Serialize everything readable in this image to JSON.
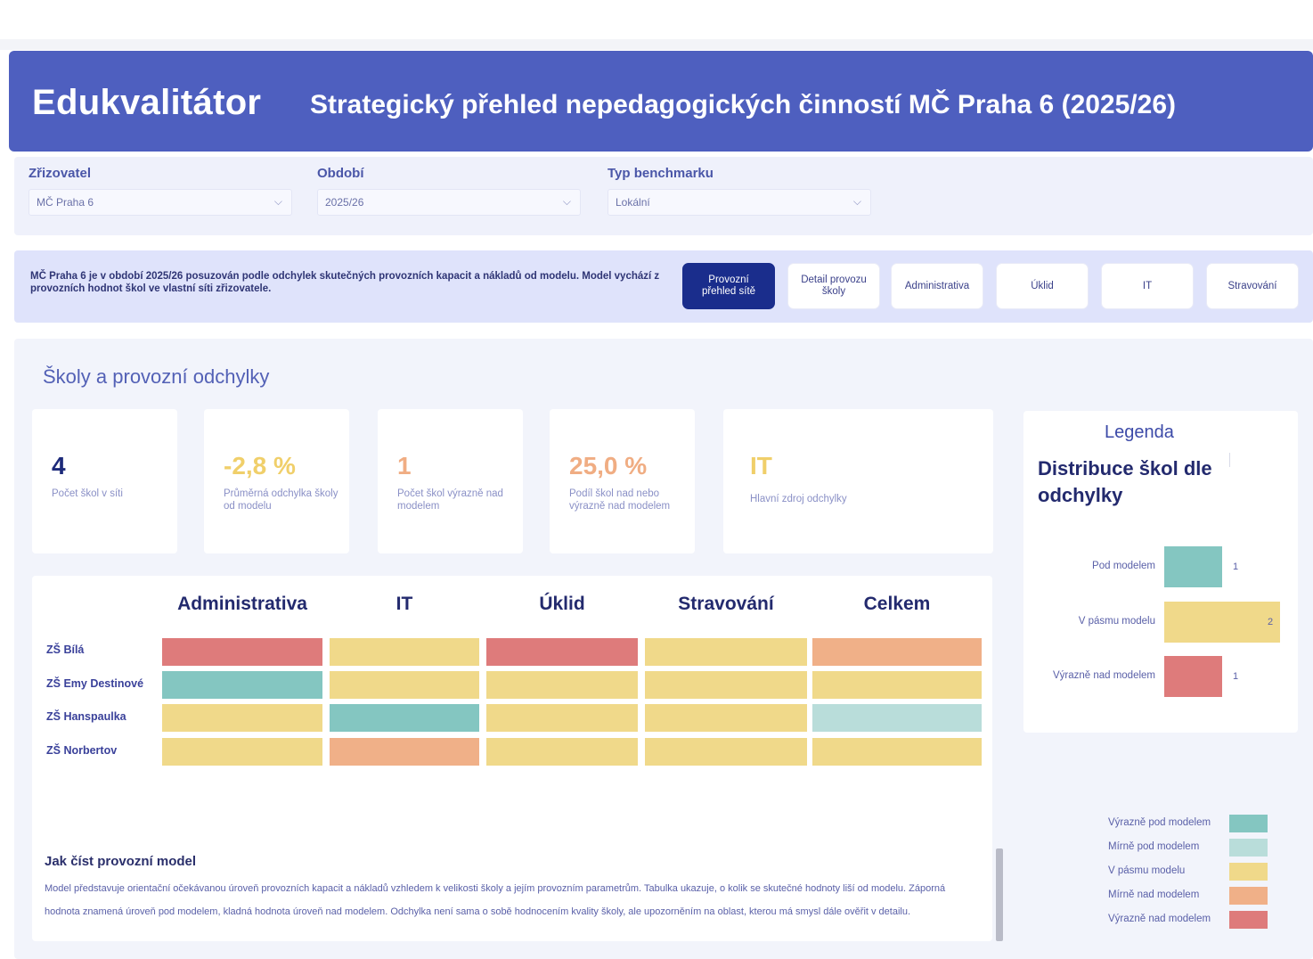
{
  "app": {
    "brand": "Edukvalitátor",
    "title": "Strategický přehled nepedagogických činností MČ Praha 6 (2025/26)"
  },
  "filters": [
    {
      "label": "Zřizovatel",
      "value": "MČ Praha 6"
    },
    {
      "label": "Období",
      "value": "2025/26"
    },
    {
      "label": "Typ benchmarku",
      "value": "Lokální"
    }
  ],
  "info": {
    "text": "MČ Praha 6 je v období 2025/26 posuzován podle odchylek skutečných provozních kapacit a nákladů od modelu. Model vychází z provozních hodnot škol ve vlastní síti zřizovatele."
  },
  "nav": [
    {
      "label": "Provozní přehled sítě",
      "active": true
    },
    {
      "label": "Detail provozu školy",
      "active": false
    },
    {
      "label": "Administrativa",
      "active": false
    },
    {
      "label": "Úklid",
      "active": false
    },
    {
      "label": "IT",
      "active": false
    },
    {
      "label": "Stravování",
      "active": false
    }
  ],
  "section": {
    "title": "Školy a provozní odchylky"
  },
  "kpis": [
    {
      "value": "4",
      "label": "Počet škol v síti",
      "color": "#1d2a7a"
    },
    {
      "value": "-2,8 %",
      "label": "Průměrná odchylka školy od modelu",
      "color": "#f0cf6a"
    },
    {
      "value": "1",
      "label": "Počet škol výrazně nad modelem",
      "color": "#f0ad83"
    },
    {
      "value": "25,0 %",
      "label": "Podíl škol nad nebo výrazně nad modelem",
      "color": "#f0ad83"
    },
    {
      "value": "IT",
      "label": "Hlavní zdroj odchylky",
      "color": "#f0cf6a"
    }
  ],
  "heatmap": {
    "columns": [
      "Administrativa",
      "IT",
      "Úklid",
      "Stravování",
      "Celkem"
    ],
    "rows": [
      {
        "name": "ZŠ Bílá",
        "cells": [
          "vyrazne_nad",
          "v_pasmu",
          "vyrazne_nad",
          "v_pasmu",
          "mirne_nad"
        ]
      },
      {
        "name": "ZŠ Emy Destinové",
        "cells": [
          "vyrazne_pod",
          "v_pasmu",
          "v_pasmu",
          "v_pasmu",
          "v_pasmu"
        ]
      },
      {
        "name": "ZŠ Hanspaulka",
        "cells": [
          "v_pasmu",
          "vyrazne_pod",
          "v_pasmu",
          "v_pasmu",
          "mirne_pod"
        ]
      },
      {
        "name": "ZŠ Norbertov",
        "cells": [
          "v_pasmu",
          "mirne_nad",
          "v_pasmu",
          "v_pasmu",
          "v_pasmu"
        ]
      }
    ]
  },
  "howto": {
    "title": "Jak číst provozní model",
    "text": "Model představuje orientační očekávanou úroveň provozních kapacit a nákladů vzhledem k velikosti školy a jejím provozním parametrům. Tabulka ukazuje, o kolik se skutečné hodnoty liší od modelu. Záporná hodnota znamená úroveň pod modelem, kladná hodnota úroveň nad modelem. Odchylka není sama o sobě hodnocením kvality školy, ale upozorněním na oblast, kterou má smysl dále ověřit v detailu."
  },
  "chart_data": {
    "type": "bar",
    "title": "Distribuce škol dle odchylky",
    "orientation": "horizontal",
    "categories": [
      "Pod modelem",
      "V pásmu modelu",
      "Výrazně nad modelem"
    ],
    "values": [
      1,
      2,
      1
    ],
    "colors": [
      "#84c6c1",
      "#f0d98a",
      "#de7b7b"
    ]
  },
  "legend": {
    "title": "Legenda",
    "items": [
      {
        "key": "vyrazne_pod",
        "label": "Výrazně pod modelem",
        "color": "#84c6c1"
      },
      {
        "key": "mirne_pod",
        "label": "Mírně pod modelem",
        "color": "#b9ddda"
      },
      {
        "key": "v_pasmu",
        "label": "V pásmu modelu",
        "color": "#f0d98a"
      },
      {
        "key": "mirne_nad",
        "label": "Mírně nad modelem",
        "color": "#f0b088"
      },
      {
        "key": "vyrazne_nad",
        "label": "Výrazně nad modelem",
        "color": "#de7b7b"
      }
    ]
  }
}
